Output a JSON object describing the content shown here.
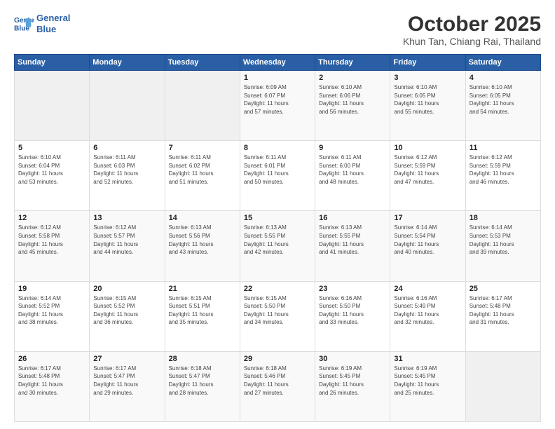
{
  "header": {
    "logo_line1": "General",
    "logo_line2": "Blue",
    "title": "October 2025",
    "subtitle": "Khun Tan, Chiang Rai, Thailand"
  },
  "weekdays": [
    "Sunday",
    "Monday",
    "Tuesday",
    "Wednesday",
    "Thursday",
    "Friday",
    "Saturday"
  ],
  "weeks": [
    [
      {
        "day": "",
        "info": ""
      },
      {
        "day": "",
        "info": ""
      },
      {
        "day": "",
        "info": ""
      },
      {
        "day": "1",
        "info": "Sunrise: 6:09 AM\nSunset: 6:07 PM\nDaylight: 11 hours\nand 57 minutes."
      },
      {
        "day": "2",
        "info": "Sunrise: 6:10 AM\nSunset: 6:06 PM\nDaylight: 11 hours\nand 56 minutes."
      },
      {
        "day": "3",
        "info": "Sunrise: 6:10 AM\nSunset: 6:05 PM\nDaylight: 11 hours\nand 55 minutes."
      },
      {
        "day": "4",
        "info": "Sunrise: 6:10 AM\nSunset: 6:05 PM\nDaylight: 11 hours\nand 54 minutes."
      }
    ],
    [
      {
        "day": "5",
        "info": "Sunrise: 6:10 AM\nSunset: 6:04 PM\nDaylight: 11 hours\nand 53 minutes."
      },
      {
        "day": "6",
        "info": "Sunrise: 6:11 AM\nSunset: 6:03 PM\nDaylight: 11 hours\nand 52 minutes."
      },
      {
        "day": "7",
        "info": "Sunrise: 6:11 AM\nSunset: 6:02 PM\nDaylight: 11 hours\nand 51 minutes."
      },
      {
        "day": "8",
        "info": "Sunrise: 6:11 AM\nSunset: 6:01 PM\nDaylight: 11 hours\nand 50 minutes."
      },
      {
        "day": "9",
        "info": "Sunrise: 6:11 AM\nSunset: 6:00 PM\nDaylight: 11 hours\nand 48 minutes."
      },
      {
        "day": "10",
        "info": "Sunrise: 6:12 AM\nSunset: 5:59 PM\nDaylight: 11 hours\nand 47 minutes."
      },
      {
        "day": "11",
        "info": "Sunrise: 6:12 AM\nSunset: 5:59 PM\nDaylight: 11 hours\nand 46 minutes."
      }
    ],
    [
      {
        "day": "12",
        "info": "Sunrise: 6:12 AM\nSunset: 5:58 PM\nDaylight: 11 hours\nand 45 minutes."
      },
      {
        "day": "13",
        "info": "Sunrise: 6:12 AM\nSunset: 5:57 PM\nDaylight: 11 hours\nand 44 minutes."
      },
      {
        "day": "14",
        "info": "Sunrise: 6:13 AM\nSunset: 5:56 PM\nDaylight: 11 hours\nand 43 minutes."
      },
      {
        "day": "15",
        "info": "Sunrise: 6:13 AM\nSunset: 5:55 PM\nDaylight: 11 hours\nand 42 minutes."
      },
      {
        "day": "16",
        "info": "Sunrise: 6:13 AM\nSunset: 5:55 PM\nDaylight: 11 hours\nand 41 minutes."
      },
      {
        "day": "17",
        "info": "Sunrise: 6:14 AM\nSunset: 5:54 PM\nDaylight: 11 hours\nand 40 minutes."
      },
      {
        "day": "18",
        "info": "Sunrise: 6:14 AM\nSunset: 5:53 PM\nDaylight: 11 hours\nand 39 minutes."
      }
    ],
    [
      {
        "day": "19",
        "info": "Sunrise: 6:14 AM\nSunset: 5:52 PM\nDaylight: 11 hours\nand 38 minutes."
      },
      {
        "day": "20",
        "info": "Sunrise: 6:15 AM\nSunset: 5:52 PM\nDaylight: 11 hours\nand 36 minutes."
      },
      {
        "day": "21",
        "info": "Sunrise: 6:15 AM\nSunset: 5:51 PM\nDaylight: 11 hours\nand 35 minutes."
      },
      {
        "day": "22",
        "info": "Sunrise: 6:15 AM\nSunset: 5:50 PM\nDaylight: 11 hours\nand 34 minutes."
      },
      {
        "day": "23",
        "info": "Sunrise: 6:16 AM\nSunset: 5:50 PM\nDaylight: 11 hours\nand 33 minutes."
      },
      {
        "day": "24",
        "info": "Sunrise: 6:16 AM\nSunset: 5:49 PM\nDaylight: 11 hours\nand 32 minutes."
      },
      {
        "day": "25",
        "info": "Sunrise: 6:17 AM\nSunset: 5:48 PM\nDaylight: 11 hours\nand 31 minutes."
      }
    ],
    [
      {
        "day": "26",
        "info": "Sunrise: 6:17 AM\nSunset: 5:48 PM\nDaylight: 11 hours\nand 30 minutes."
      },
      {
        "day": "27",
        "info": "Sunrise: 6:17 AM\nSunset: 5:47 PM\nDaylight: 11 hours\nand 29 minutes."
      },
      {
        "day": "28",
        "info": "Sunrise: 6:18 AM\nSunset: 5:47 PM\nDaylight: 11 hours\nand 28 minutes."
      },
      {
        "day": "29",
        "info": "Sunrise: 6:18 AM\nSunset: 5:46 PM\nDaylight: 11 hours\nand 27 minutes."
      },
      {
        "day": "30",
        "info": "Sunrise: 6:19 AM\nSunset: 5:45 PM\nDaylight: 11 hours\nand 26 minutes."
      },
      {
        "day": "31",
        "info": "Sunrise: 6:19 AM\nSunset: 5:45 PM\nDaylight: 11 hours\nand 25 minutes."
      },
      {
        "day": "",
        "info": ""
      }
    ]
  ]
}
